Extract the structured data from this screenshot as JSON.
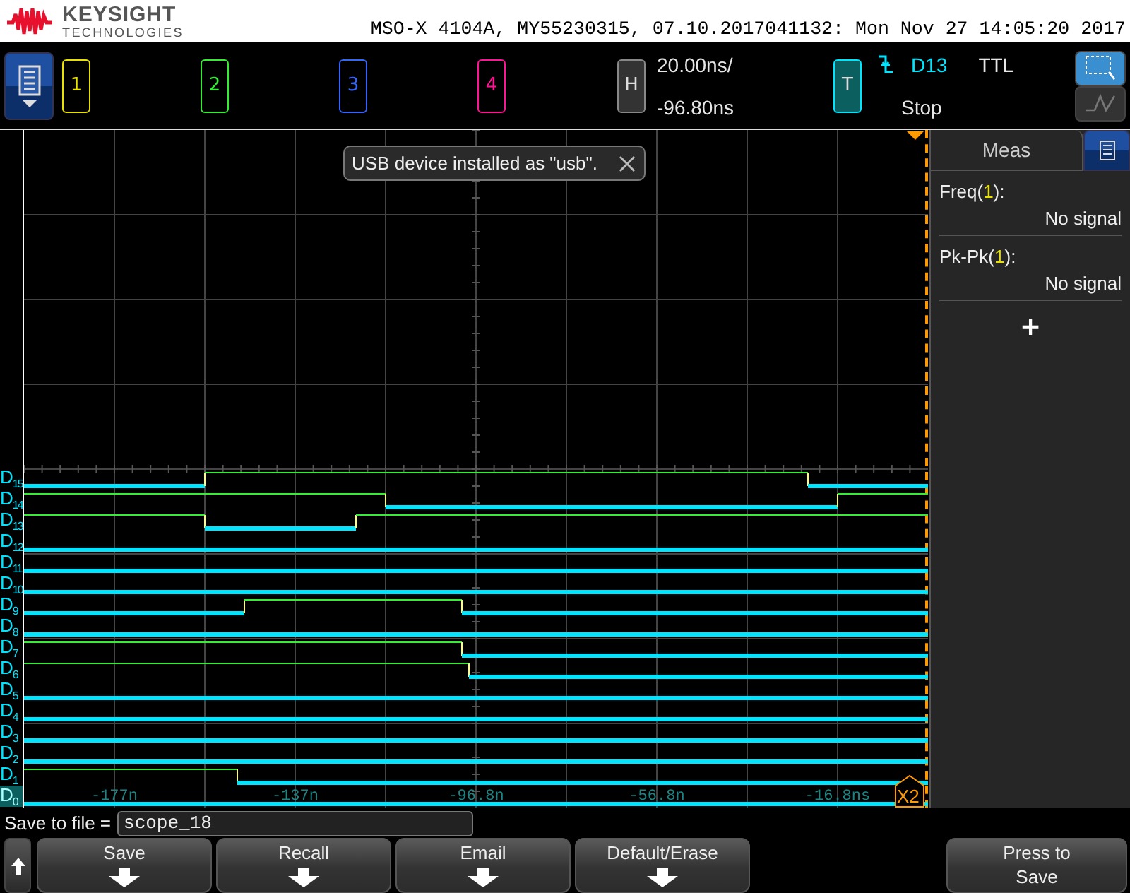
{
  "header": {
    "brand": "KEYSIGHT",
    "brand_sub": "TECHNOLOGIES",
    "title": "MSO-X 4104A, MY55230315, 07.10.2017041132: Mon Nov 27 14:05:20 2017"
  },
  "channels": [
    {
      "label": "1",
      "color": "#e8e000"
    },
    {
      "label": "2",
      "color": "#33ee33"
    },
    {
      "label": "3",
      "color": "#3366ff"
    },
    {
      "label": "4",
      "color": "#ff1493"
    }
  ],
  "horizontal": {
    "label": "H",
    "scale": "20.00ns/",
    "delay": "-96.80ns"
  },
  "trigger": {
    "label": "T",
    "source": "D13",
    "threshold": "TTL",
    "status": "Stop"
  },
  "notification": {
    "text": "USB device installed as \"usb\"."
  },
  "digital_channels": [
    {
      "label": "D$_{15}$",
      "selected": false
    },
    {
      "label": "D$_{14}$",
      "selected": false
    },
    {
      "label": "D$_{13}$",
      "selected": false
    },
    {
      "label": "D$_{12}$",
      "selected": false
    },
    {
      "label": "D$_{11}$",
      "selected": false
    },
    {
      "label": "D$_{10}$",
      "selected": false
    },
    {
      "label": "D$_{9}$",
      "selected": false
    },
    {
      "label": "D$_{8}$",
      "selected": false
    },
    {
      "label": "D$_{7}$",
      "selected": false
    },
    {
      "label": "D$_{6}$",
      "selected": false
    },
    {
      "label": "D$_{5}$",
      "selected": false
    },
    {
      "label": "D$_{4}$",
      "selected": false
    },
    {
      "label": "D$_{3}$",
      "selected": false
    },
    {
      "label": "D$_{2}$",
      "selected": false
    },
    {
      "label": "D$_{1}$",
      "selected": false
    },
    {
      "label": "D$_{0}$",
      "selected": true
    }
  ],
  "time_axis": [
    "-177n",
    "-137n",
    "-96.8n",
    "-56.8n",
    "-16.8ns"
  ],
  "marker": "X2",
  "meas_panel": {
    "tab": "Meas",
    "items": [
      {
        "name": "Freq(",
        "source": "1",
        "suffix": "):",
        "value": "No signal"
      },
      {
        "name": "Pk-Pk(",
        "source": "1",
        "suffix": "):",
        "value": "No signal"
      }
    ],
    "add": "+"
  },
  "save_row": {
    "label": "Save to file =",
    "value": "scope_18"
  },
  "softkeys": [
    {
      "label": "Save"
    },
    {
      "label": "Recall"
    },
    {
      "label": "Email"
    },
    {
      "label": "Default/Erase"
    }
  ],
  "action_key": {
    "lines": [
      "Press to",
      "Save"
    ]
  }
}
